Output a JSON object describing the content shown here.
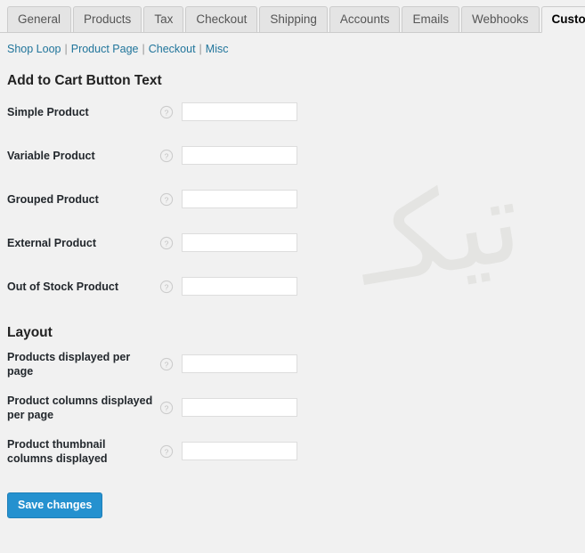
{
  "tabs": [
    {
      "label": "General",
      "active": false
    },
    {
      "label": "Products",
      "active": false
    },
    {
      "label": "Tax",
      "active": false
    },
    {
      "label": "Checkout",
      "active": false
    },
    {
      "label": "Shipping",
      "active": false
    },
    {
      "label": "Accounts",
      "active": false
    },
    {
      "label": "Emails",
      "active": false
    },
    {
      "label": "Webhooks",
      "active": false
    },
    {
      "label": "Customizer",
      "active": true
    }
  ],
  "subnav": {
    "items": [
      "Shop Loop",
      "Product Page",
      "Checkout",
      "Misc"
    ],
    "separator": "|"
  },
  "sections": [
    {
      "title": "Add to Cart Button Text",
      "fields": [
        {
          "label": "Simple Product",
          "value": "",
          "placeholder": "",
          "help": "help-icon"
        },
        {
          "label": "Variable Product",
          "value": "",
          "placeholder": "",
          "help": "help-icon"
        },
        {
          "label": "Grouped Product",
          "value": "",
          "placeholder": "",
          "help": "help-icon"
        },
        {
          "label": "External Product",
          "value": "",
          "placeholder": "",
          "help": "help-icon"
        },
        {
          "label": "Out of Stock Product",
          "value": "",
          "placeholder": "",
          "help": "help-icon"
        }
      ]
    },
    {
      "title": "Layout",
      "fields": [
        {
          "label": "Products displayed per page",
          "value": "",
          "placeholder": "",
          "help": "help-icon"
        },
        {
          "label": "Product columns displayed per page",
          "value": "",
          "placeholder": "",
          "help": "help-icon"
        },
        {
          "label": "Product thumbnail columns displayed",
          "value": "",
          "placeholder": "",
          "help": "help-icon"
        }
      ]
    }
  ],
  "submit": {
    "save_label": "Save changes"
  },
  "watermark": {
    "text": "تیکـ"
  },
  "colors": {
    "page_background": "#f1f1f1",
    "tab_inactive_background": "#e4e4e4",
    "tab_border": "#cccccc",
    "link_blue": "#21759b",
    "save_button_blue": "#2591cf",
    "label_text": "#23282d",
    "input_border": "#dddddd",
    "watermark_gray": "#e4e4e2"
  }
}
